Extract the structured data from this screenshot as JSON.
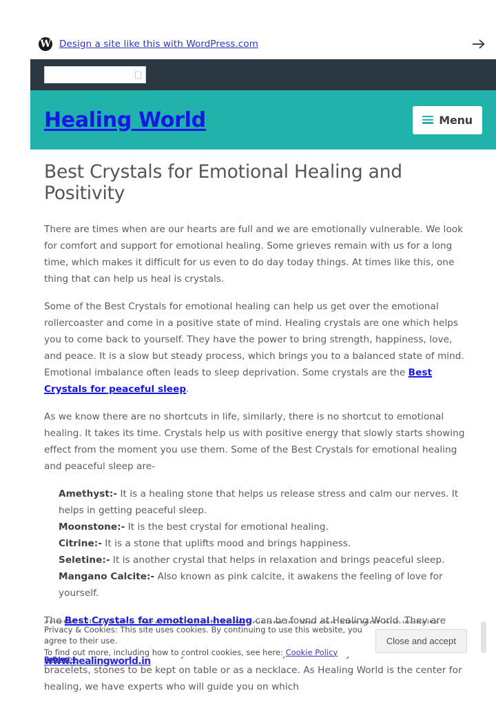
{
  "promo_bar": {
    "logo_icon": "wordpress-logo-icon",
    "link_text": "Design a site like this with WordPress.com",
    "arrow_icon": "arrow-right-icon"
  },
  "search_bar": {
    "value": "",
    "placeholder": "",
    "glyph_icon": "missing-glyph-icon"
  },
  "site_header": {
    "title": "Healing World",
    "background_color": "#20b2ab",
    "title_color": "#1616e6",
    "menu": {
      "label": "Menu",
      "icon": "hamburger-menu-icon"
    }
  },
  "article": {
    "title": "Best Crystals for Emotional Healing and Positivity",
    "paragraph_1": "There are times when are our hearts are full and we are emotionally vulnerable. We look for comfort and support for emotional healing. Some grieves remain with us for a long time, which makes it difficult for us even to do day today things. At times like this, one thing that can help us heal is crystals.",
    "paragraph_2_before": "Some of the Best Crystals for emotional healing can help us get over the emotional rollercoaster and come in a positive state of mind. Healing crystals are one which helps you to come back to yourself. They have the power to bring strength, happiness, love, and peace. It is a slow but steady process, which brings you to a balanced state of mind. Emotional imbalance often leads to sleep deprivation. Some crystals are the ",
    "paragraph_2_link": "Best Crystals for peaceful sleep",
    "paragraph_2_after": ".",
    "paragraph_3": "As we know there are no shortcuts in life, similarly, there is no shortcut to emotional healing. It takes its time. Crystals help us with positive energy that slowly starts showing effect from the moment you use them. Some of the Best Crystals for emotional healing and peaceful sleep are-",
    "list": [
      {
        "term": "Amethyst:-",
        "desc": " It is a healing stone that helps us release stress and calm our nerves. It helps in getting peaceful sleep."
      },
      {
        "term": "Moonstone:-",
        "desc": " It is the best crystal for emotional healing."
      },
      {
        "term": "Citrine:-",
        "desc": " It is a stone that uplifts mood and brings happiness."
      },
      {
        "term": "Seletine:-",
        "desc": " It is another crystal that helps in relaxation and brings peaceful sleep."
      },
      {
        "term": "Mangano Calcite:-",
        "desc": " Also known as pink calcite, it awakens the feeling of love for yourself."
      }
    ],
    "paragraph_4_before": "The ",
    "paragraph_4_link": "Best Crystals for emotional healing",
    "paragraph_4_after": " can be found at Healing World. They are authentic and you will slowly start feeling positivity in yourself after using them. The crystals are available in many different forms and patterns. They are available as bracelets, stones to be kept on table or as a necklace. As Healing World is the center for healing, we have experts who will guide you on which",
    "clipped_line": "crystal will suit you based on the situation you are in. You can also visit our website"
  },
  "footer_cluster": {
    "site_link": "www.healingworld.in",
    "reblog_label": "Reblog",
    "subscribe_label": "Subscribe"
  },
  "cookie_banner": {
    "line_1": "Privacy & Cookies: This site uses cookies. By continuing to use this website, you agree to their use.",
    "line_2_before": "To find out more, including how to control cookies, see here: ",
    "policy_link": "Cookie Policy",
    "accept_button": "Close and accept"
  }
}
